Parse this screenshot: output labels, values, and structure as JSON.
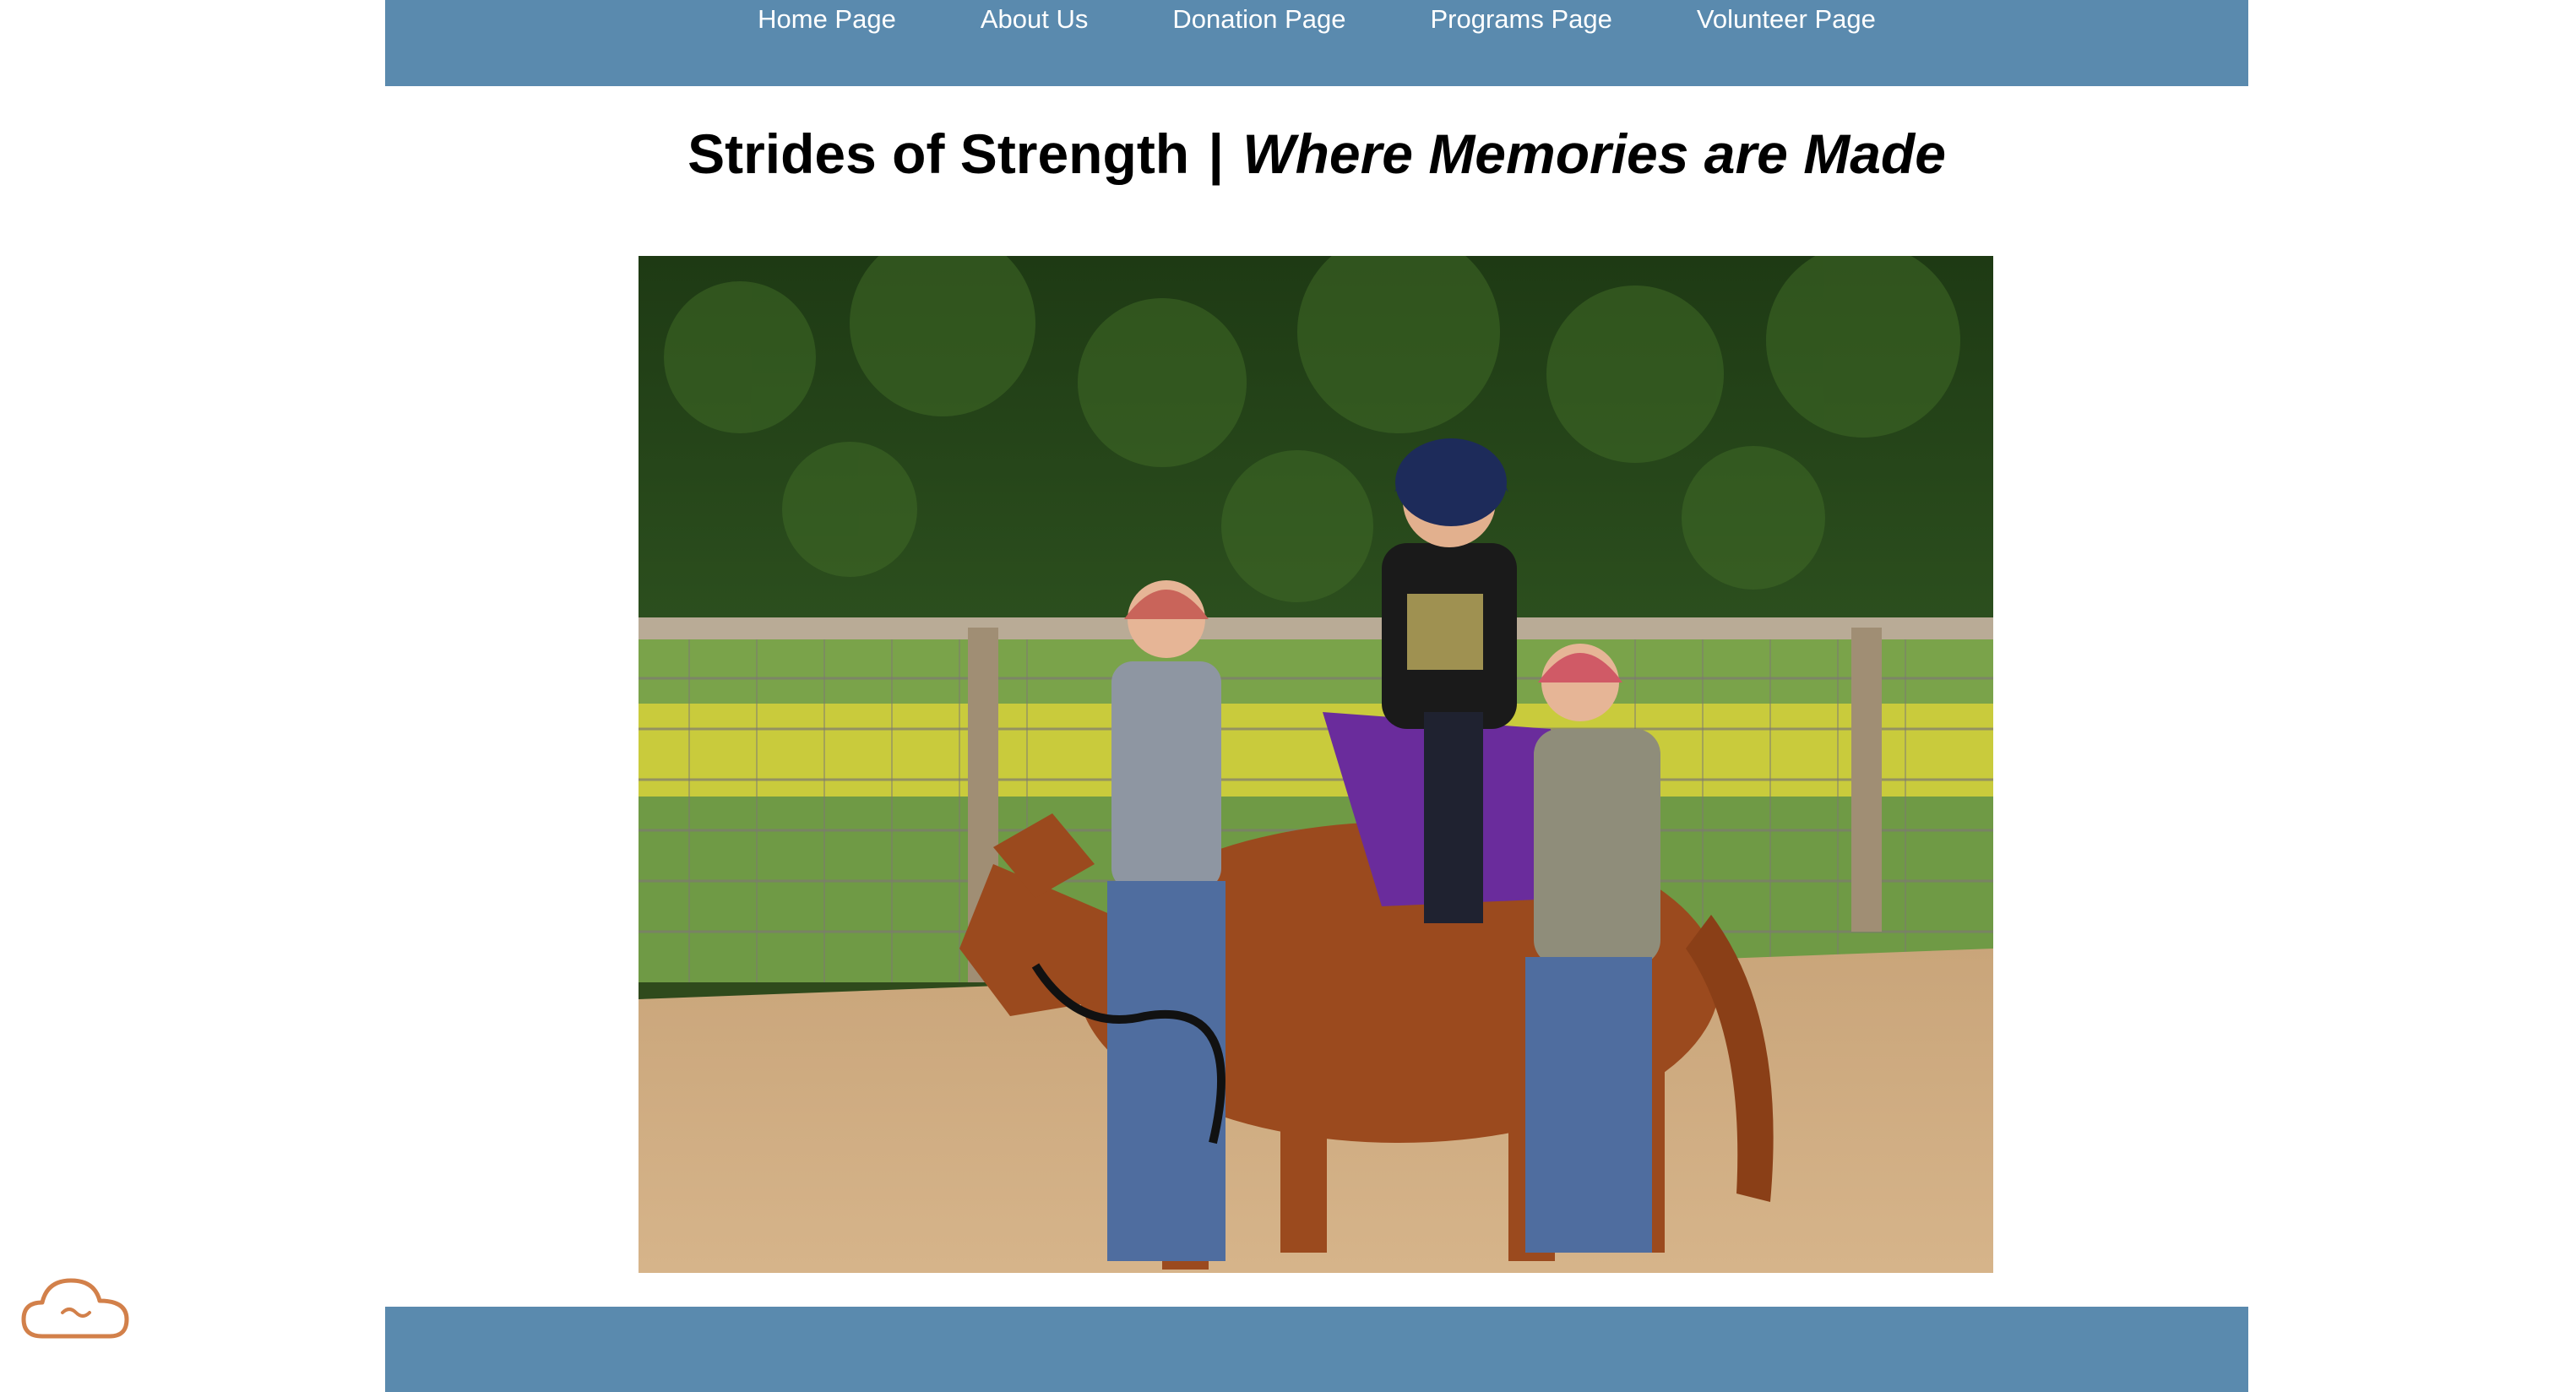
{
  "nav": {
    "items": [
      {
        "label": "Home Page"
      },
      {
        "label": "About Us"
      },
      {
        "label": "Donation Page"
      },
      {
        "label": "Programs Page"
      },
      {
        "label": "Volunteer Page"
      }
    ]
  },
  "header": {
    "title_main": "Strides of Strength",
    "title_sep": "|",
    "title_tagline": "Where Memories are Made"
  },
  "hero": {
    "alt": "Child wearing a helmet riding a chestnut horse with a purple saddle pad, led by a volunteer and supported by side walkers in a sand arena"
  },
  "widget": {
    "icon": "cloud-icon"
  },
  "colors": {
    "bar": "#5a8aae",
    "widget_stroke": "#d2804a"
  }
}
